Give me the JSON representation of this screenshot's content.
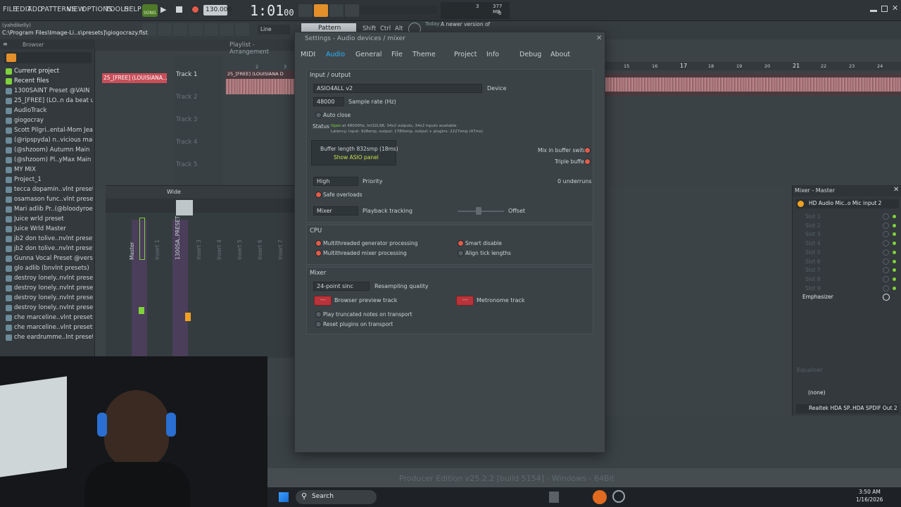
{
  "topbar": {
    "menus": [
      "FILE",
      "EDIT",
      "ADD",
      "PATTERNS",
      "VIEW",
      "OPTIONS",
      "TOOLS",
      "HELP"
    ],
    "song_label": "SONG",
    "tempo": "130.000",
    "time": "1:01",
    "time_frac": "00",
    "cpu": "3",
    "ram": "377 MB",
    "poly": "0",
    "pattern_label": "Pattern 1",
    "line_label": "Line",
    "shift": "Shift",
    "ctrl": "Ctrl",
    "alt": "Alt",
    "news_today": "Today",
    "news_text": "A newer version of"
  },
  "hint": "(yahdikelly)",
  "path": "C:\\Program Files\\Image-Li..s\\presets]\\giogocrazy.flst",
  "browser": {
    "title": "Browser",
    "items": [
      "Current project",
      "Recent files",
      "1300SAINT Preset @VAIN",
      "25_[FREE] (LO..n da beat up",
      "AudioTrack",
      "giogocray",
      "Scott Pilgri..ental-Mom Jeans",
      "(@ripspyda) n..vicious main",
      "(@shzoom) Autumn Main",
      "(@shzoom) Pl..yMax Main FV",
      "MY MIX",
      "Project_1",
      "tecca dopamin..vlnt presets)",
      "osamason func..vlnt presets)",
      "Mari adlib Pr..(@bloodyroel)",
      "Juice wrld preset",
      "Juice Wrld Master",
      "jb2 don tolive..nvlnt presets)",
      "jb2 don tolive..nvlnt presets)",
      "Gunna Vocal Preset @versial",
      "glo adlib (bnvlnt presets)",
      "destroy lonely..nvlnt presets)",
      "destroy lonely..nvlnt presets)",
      "destroy lonely..nvlnt presets)",
      "destroy lonely..nvlnt presets)",
      "che marceline..vlnt presets)",
      "che marceline..vlnt presets)",
      "che eardrumme..lnt presets)"
    ]
  },
  "playlist": {
    "title": "Playlist - Arrangement",
    "clip_name": "25_[FREE] (LOUISIANA...",
    "clip_top": "25_[FREE] (LOUISIANA D",
    "tracks": [
      "Track 1",
      "Track 2",
      "Track 3",
      "Track 4",
      "Track 5"
    ],
    "bar_numbers": [
      "2",
      "3",
      "4"
    ],
    "right_bar_numbers": [
      "15",
      "16",
      "17",
      "18",
      "19",
      "20",
      "21",
      "22",
      "23",
      "24"
    ]
  },
  "mixer": {
    "wide_label": "Wide",
    "channels": [
      "Master",
      "Insert 1",
      "1300SA..PRESET",
      "Insert 3",
      "Insert 4",
      "Insert 5",
      "Insert 6",
      "Insert 7"
    ],
    "header_nums": [
      "C",
      "M",
      "1",
      "2",
      "3",
      "4",
      "5",
      "6",
      "7"
    ]
  },
  "settings": {
    "title": "Settings - Audio devices / mixer",
    "tabs": [
      "MIDI",
      "Audio",
      "General",
      "File",
      "Theme",
      "Project",
      "Info",
      "Debug",
      "About"
    ],
    "active_tab": "Audio",
    "io_header": "Input / output",
    "device_value": "ASIO4ALL v2",
    "device_label": "Device",
    "sample_rate": "48000",
    "sample_rate_label": "Sample rate (Hz)",
    "auto_close": "Auto close",
    "status_label": "Status",
    "status_open": "Open",
    "status_line1": "at 48000Hz, Int32LSB, 34x2 outputs, 34x2 inputs available",
    "status_line2": "Latency: input: 928smp, output: 1780smp, output + plugins: 2227smp (47ms)",
    "buffer_length": "Buffer length 832smp (18ms)",
    "show_asio": "Show ASIO panel",
    "mix_in_buffer": "Mix in buffer switch",
    "triple_buffer": "Triple buffer",
    "priority_value": "High",
    "priority_label": "Priority",
    "underruns": "0 underruns",
    "safe_overloads": "Safe overloads",
    "playback_value": "Mixer",
    "playback_label": "Playback tracking",
    "offset": "Offset",
    "cpu_header": "CPU",
    "multi_gen": "Multithreaded generator processing",
    "multi_mix": "Multithreaded mixer processing",
    "smart_disable": "Smart disable",
    "align_ticks": "Align tick lengths",
    "mixer_header": "Mixer",
    "resampling_value": "24-point sinc",
    "resampling_label": "Resampling quality",
    "browser_preview": "Browser preview track",
    "metronome": "Metronome track",
    "track_btn": "---",
    "play_truncated": "Play truncated notes on transport",
    "reset_plugins": "Reset plugins on transport"
  },
  "mixer_master": {
    "title": "Mixer - Master",
    "input": "HD Audio Mic..o Mic input 2",
    "slots": [
      "Slot 1",
      "Slot 2",
      "Slot 3",
      "Slot 4",
      "Slot 5",
      "Slot 6",
      "Slot 7",
      "Slot 8",
      "Slot 9"
    ],
    "fx": "Emphasizer",
    "equaliser": "Equaliser",
    "none": "(none)",
    "output": "Realtek HDA SP..HDA SPDIF Out 2"
  },
  "status_bar": {
    "producer": "Producer Edition v25.2.2 [build 5154] - Windows - 64Bit"
  },
  "taskbar": {
    "search": "Search",
    "time": "3:50 AM",
    "date": "1/16/2026"
  },
  "colors": {
    "accent_blue": "#2fb0ff",
    "led_green": "#7fd23a",
    "record_red": "#e45b4b",
    "orange": "#f0a020"
  }
}
